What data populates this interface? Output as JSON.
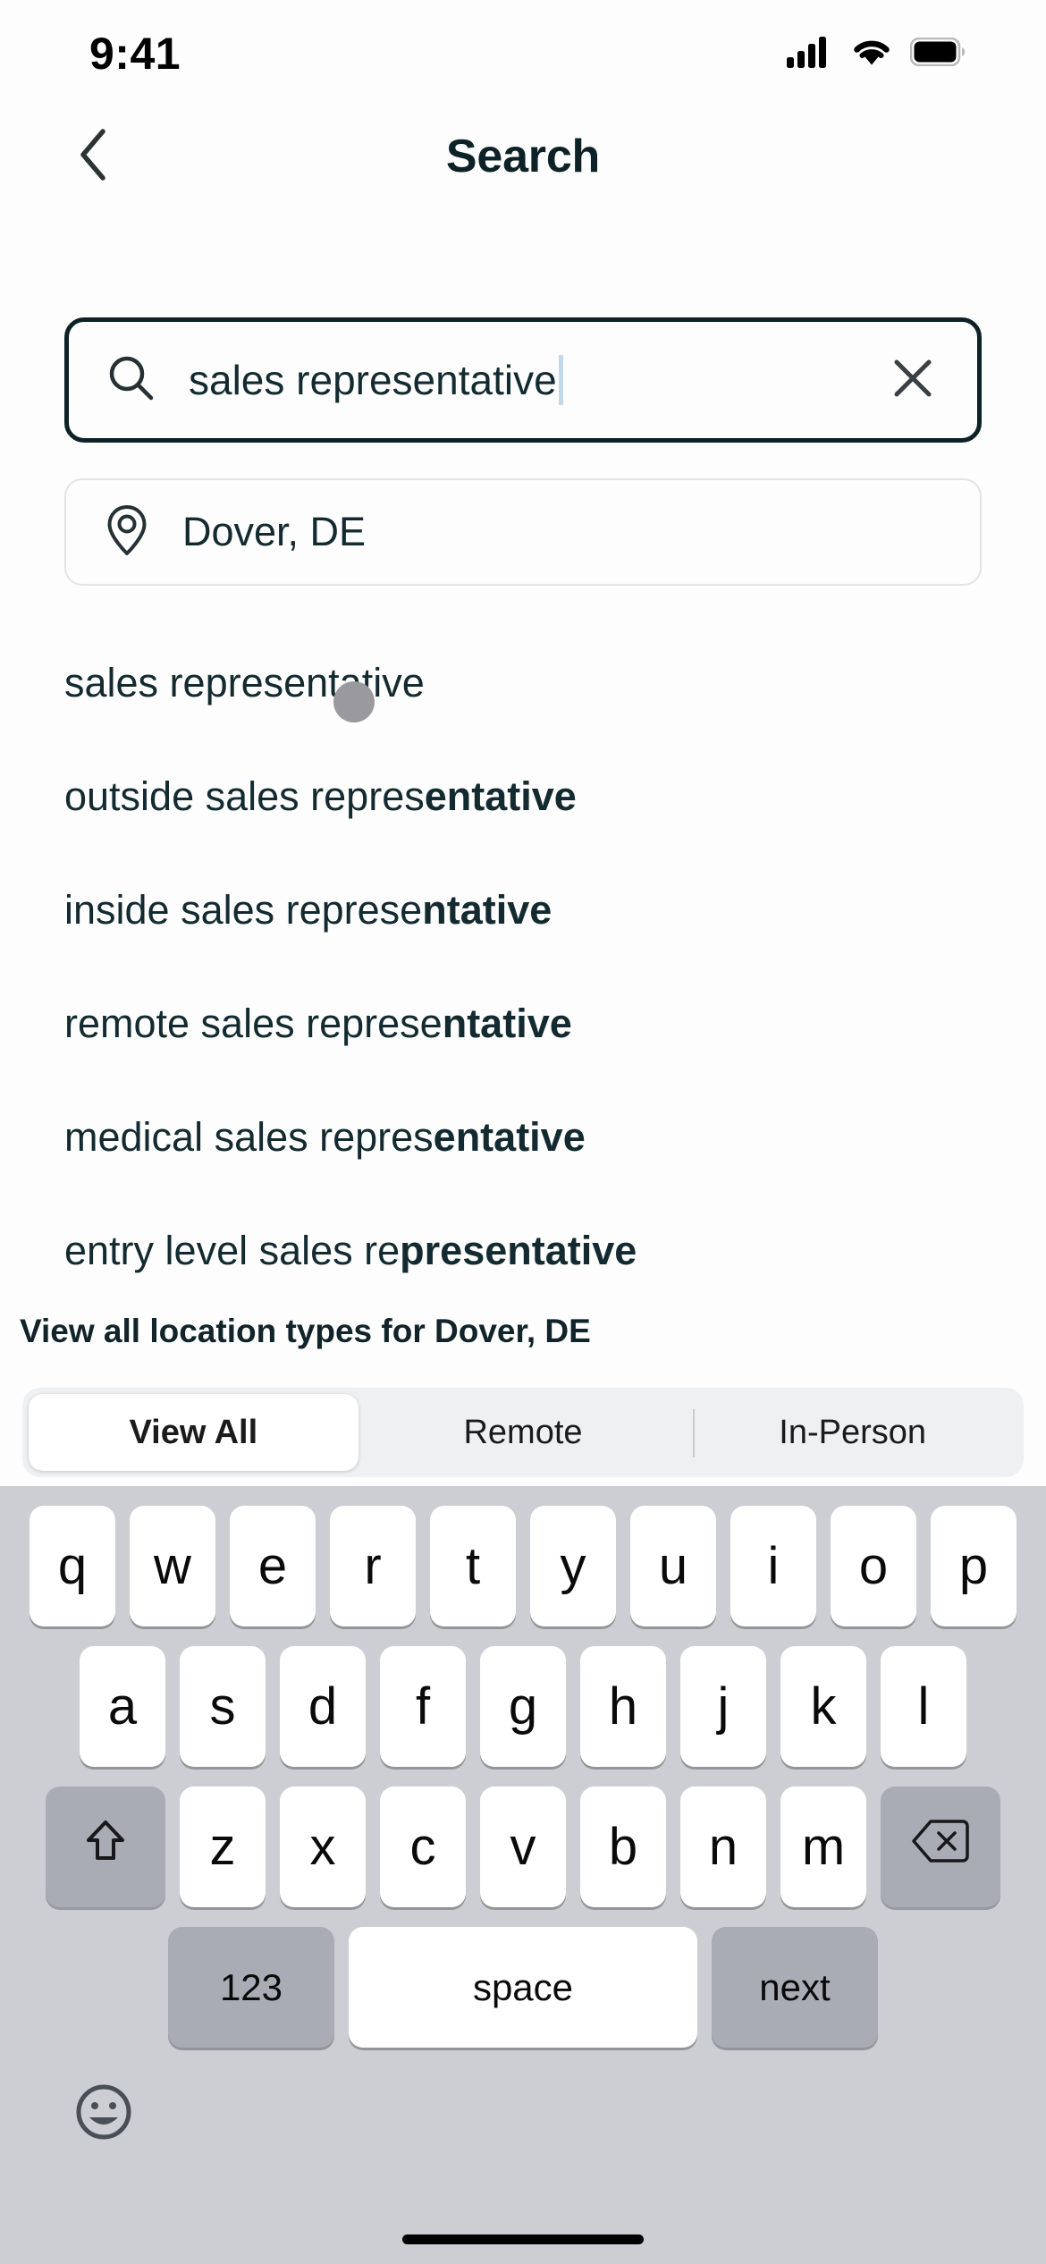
{
  "status_bar": {
    "time": "9:41",
    "cellular_icon": "cellular-signal-icon",
    "wifi_icon": "wifi-icon",
    "battery_icon": "battery-full-icon"
  },
  "header": {
    "back_icon": "chevron-left-icon",
    "title": "Search"
  },
  "search": {
    "icon": "search-magnifier-icon",
    "value": "sales representative",
    "placeholder": "Search jobs",
    "clear_icon": "close-x-icon",
    "cursor_color": "#c3d8e8",
    "border_color": "#0d2227"
  },
  "location": {
    "icon": "map-pin-icon",
    "value": "Dover, DE",
    "placeholder": "Location"
  },
  "suggestions": [
    {
      "plain": "sales representative",
      "bold": ""
    },
    {
      "plain": "outside sales repres",
      "bold": "entative"
    },
    {
      "plain": "inside sales represe",
      "bold": "ntative"
    },
    {
      "plain": "remote sales represe",
      "bold": "ntative"
    },
    {
      "plain": "medical sales repres",
      "bold": "entative"
    },
    {
      "plain": "entry level sales re",
      "bold": "presentative"
    }
  ],
  "section": {
    "heading": "View all location types for Dover, DE"
  },
  "segmented": {
    "options": [
      {
        "label": "View All",
        "active": true
      },
      {
        "label": "Remote",
        "active": false
      },
      {
        "label": "In-Person",
        "active": false
      }
    ]
  },
  "keyboard": {
    "row1": [
      "q",
      "w",
      "e",
      "r",
      "t",
      "y",
      "u",
      "i",
      "o",
      "p"
    ],
    "row2": [
      "a",
      "s",
      "d",
      "f",
      "g",
      "h",
      "j",
      "k",
      "l"
    ],
    "row3": [
      "z",
      "x",
      "c",
      "v",
      "b",
      "n",
      "m"
    ],
    "shift_icon": "shift-arrow-icon",
    "backspace_icon": "backspace-delete-icon",
    "numeric_label": "123",
    "space_label": "space",
    "return_label": "next",
    "emoji_icon": "emoji-smiley-icon"
  },
  "theme": {
    "accent": "#0d2227",
    "text": "#132b30",
    "keyboard_bg": "#cdced4",
    "key_bg": "#ffffff",
    "fn_key_bg": "#a9acb4",
    "touch_indicator": "#9a9a9e"
  }
}
